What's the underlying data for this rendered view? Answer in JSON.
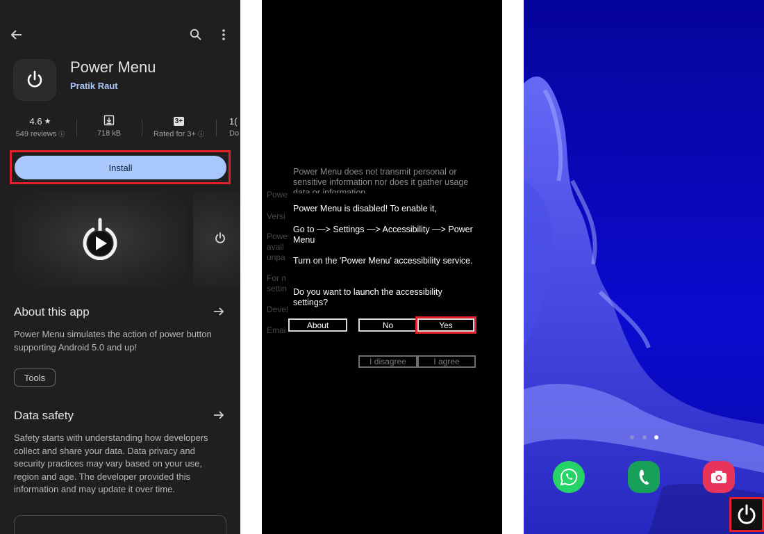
{
  "store": {
    "app_name": "Power Menu",
    "developer": "Pratik Raut",
    "rating": "4.6",
    "reviews": "549 reviews",
    "size": "718 kB",
    "age_badge": "3+",
    "age_rating": "Rated for 3+",
    "downloads_top": "1(",
    "downloads_bottom": "Do",
    "install_label": "Install",
    "about_title": "About this app",
    "about_text": "Power Menu simulates the action of power button supporting Android 5.0 and up!",
    "category_chip": "Tools",
    "safety_title": "Data safety",
    "safety_text": "Safety starts with understanding how developers collect and share your data. Data privacy and security practices may vary based on your use, region and age. The developer provided this information and may update it over time."
  },
  "dialog": {
    "bg_partial": [
      "Powe",
      "Versi",
      "Powe",
      "avail",
      "unpa",
      "For n",
      "settin",
      "Devel",
      "Emai"
    ],
    "bg_text": "Power Menu does not transmit personal or sensitive information nor does it gather usage data or information.",
    "msg_disabled": "Power Menu is disabled! To enable it,",
    "msg_path": "Go to —> Settings —> Accessibility —> Power Menu",
    "msg_turn_on": "Turn on the 'Power Menu' accessibility service.",
    "msg_question": "Do you want to launch the accessibility settings?",
    "btn_about": "About",
    "btn_no": "No",
    "btn_yes": "Yes",
    "btn_disagree": "I disagree",
    "btn_agree": "I agree"
  },
  "colors": {
    "highlight": "#e2202c",
    "install_button": "#a8c7fa",
    "store_bg": "#1f1f1f",
    "wallpaper": "#0b0bd0"
  },
  "home": {
    "page_indicator": {
      "count": 3,
      "active": 3
    },
    "dock_apps": [
      "whatsapp-icon",
      "phone-icon",
      "camera-icon"
    ],
    "shortcut": "power-icon"
  }
}
